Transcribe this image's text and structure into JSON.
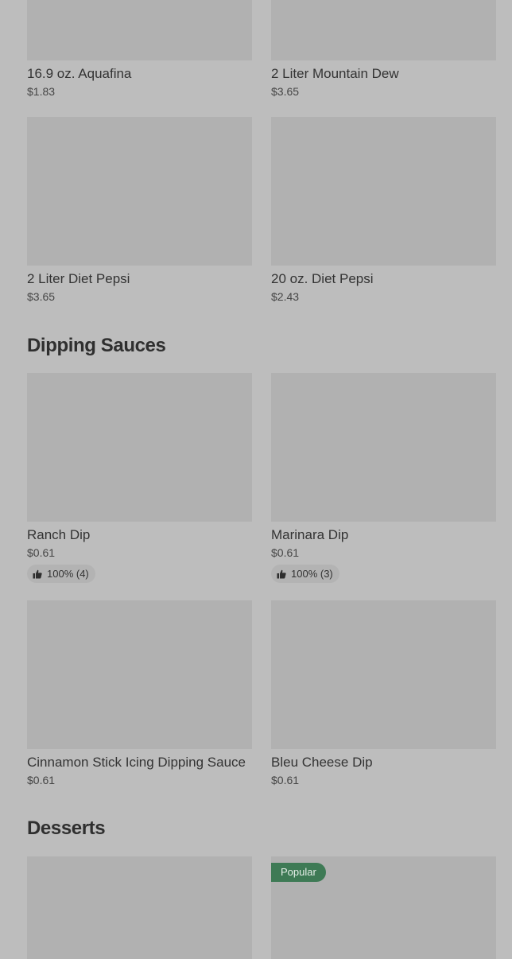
{
  "sections": {
    "dipping_sauces": {
      "title": "Dipping Sauces"
    },
    "desserts": {
      "title": "Desserts"
    }
  },
  "drinks": [
    {
      "name": "16.9 oz. Aquafina",
      "price": "$1.83"
    },
    {
      "name": "2 Liter Mountain Dew",
      "price": "$3.65"
    },
    {
      "name": "2 Liter Diet Pepsi",
      "price": "$3.65"
    },
    {
      "name": "20 oz. Diet Pepsi",
      "price": "$2.43"
    }
  ],
  "sauces": [
    {
      "name": "Ranch Dip",
      "price": "$0.61",
      "rating": "100% (4)"
    },
    {
      "name": "Marinara Dip",
      "price": "$0.61",
      "rating": "100% (3)"
    },
    {
      "name": "Cinnamon Stick Icing Dipping Sauce",
      "price": "$0.61"
    },
    {
      "name": "Bleu Cheese Dip",
      "price": "$0.61"
    }
  ],
  "desserts": [
    {
      "badge": "Popular"
    }
  ],
  "icons": {
    "rating": "thumbs-up-icon"
  },
  "colors": {
    "background": "#bdbdbd",
    "image_placeholder": "#b1b1b1",
    "popular_badge": "#3e7a55"
  }
}
